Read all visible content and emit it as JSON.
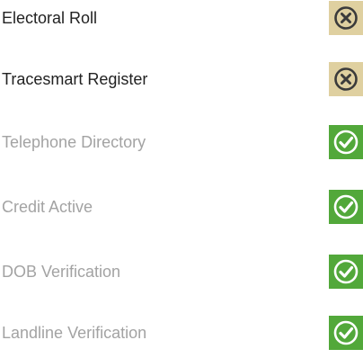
{
  "colors": {
    "fail_bg": "#dfd0a0",
    "fail_icon": "#3b3b3b",
    "pass_bg": "#52a83a",
    "pass_icon": "#ffffff",
    "label_active": "#222222",
    "label_muted": "#a3a3a3"
  },
  "checks": [
    {
      "label": "Electoral Roll",
      "status": "fail",
      "icon": "close-circle-icon"
    },
    {
      "label": "Tracesmart Register",
      "status": "fail",
      "icon": "close-circle-icon"
    },
    {
      "label": "Telephone Directory",
      "status": "pass",
      "icon": "check-circle-icon"
    },
    {
      "label": "Credit Active",
      "status": "pass",
      "icon": "check-circle-icon"
    },
    {
      "label": "DOB Verification",
      "status": "pass",
      "icon": "check-circle-icon"
    },
    {
      "label": "Landline Verification",
      "status": "pass",
      "icon": "check-circle-icon"
    }
  ]
}
